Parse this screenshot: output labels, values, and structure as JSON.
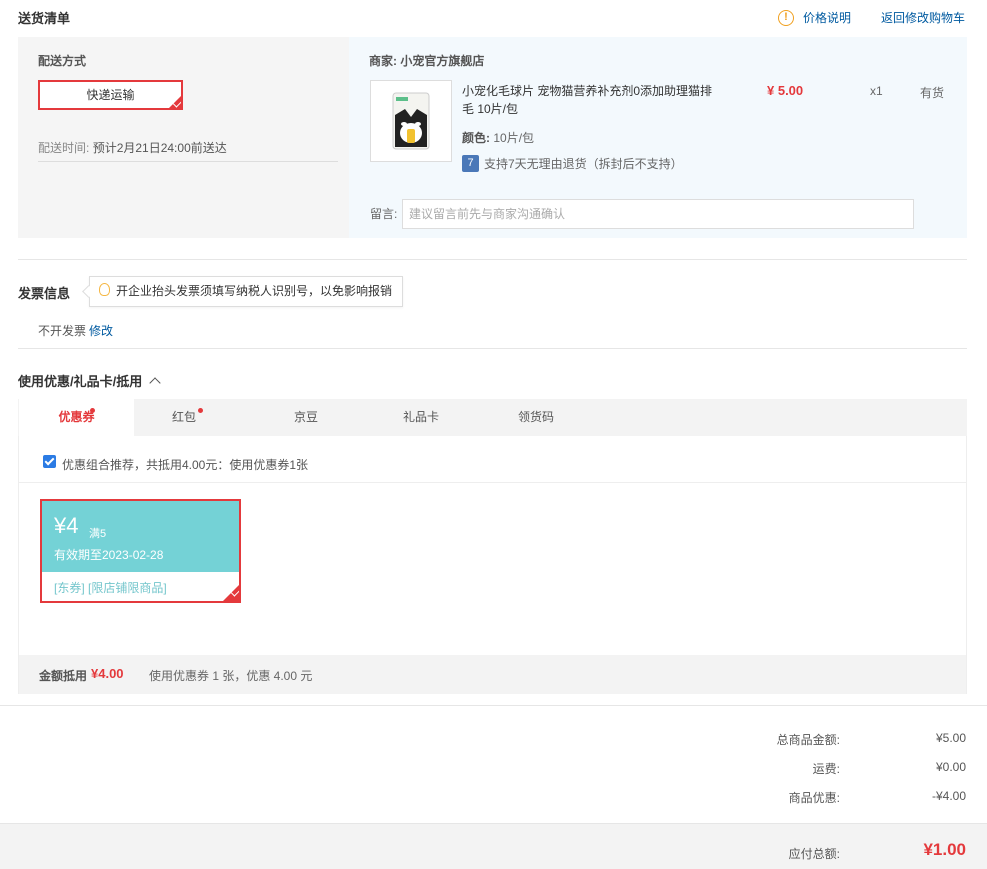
{
  "header": {
    "title": "送货清单",
    "price_info": "价格说明",
    "back_to_cart": "返回修改购物车"
  },
  "shipping": {
    "method_label": "配送方式",
    "method_value": "快递运输",
    "time_label": "配送时间:",
    "time_value": "预计2月21日24:00前送达"
  },
  "merchant": {
    "label": "商家:",
    "name": "小宠官方旗舰店"
  },
  "product": {
    "name": "小宠化毛球片 宠物猫营养补充剂0添加助理猫排毛 10片/包",
    "color_label": "颜色:",
    "color_value": "10片/包",
    "return_badge": "7",
    "return_text": "支持7天无理由退货（拆封后不支持）",
    "price": "¥ 5.00",
    "qty": "x1",
    "stock": "有货"
  },
  "message": {
    "label": "留言:",
    "placeholder": "建议留言前先与商家沟通确认"
  },
  "invoice": {
    "title": "发票信息",
    "tip": "开企业抬头发票须填写纳税人识别号，以免影响报销",
    "status": "不开发票",
    "edit": "修改"
  },
  "coupons": {
    "title": "使用优惠/礼品卡/抵用",
    "tabs": [
      {
        "label": "优惠券"
      },
      {
        "label": "红包"
      },
      {
        "label": "京豆"
      },
      {
        "label": "礼品卡"
      },
      {
        "label": "领货码"
      }
    ],
    "recommend": "优惠组合推荐，共抵用4.00元：使用优惠券1张",
    "card": {
      "amount": "¥4",
      "condition": "满5",
      "expiry": "有效期至2023-02-28",
      "tags": "[东券]  [限店铺限商品]"
    },
    "summary_label": "金额抵用",
    "summary_value": "¥4.00",
    "summary_desc": "使用优惠券 1 张，优惠 4.00 元"
  },
  "totals": {
    "items_label": "总商品金额:",
    "items_value": "¥5.00",
    "shipping_label": "运费:",
    "shipping_value": "¥0.00",
    "discount_label": "商品优惠:",
    "discount_value": "-¥4.00",
    "payable_label": "应付总额:",
    "payable_value": "¥1.00"
  },
  "colors": {
    "accent_red": "#e4393c",
    "link_blue": "#005aa0",
    "coupon_teal": "#74d2d6"
  }
}
